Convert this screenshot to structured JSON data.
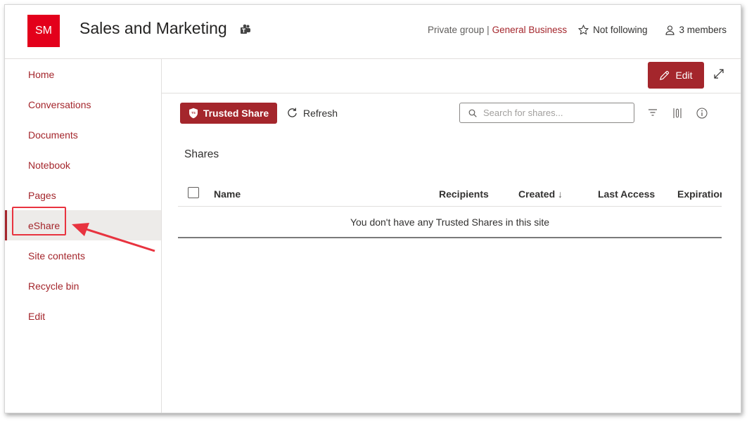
{
  "site": {
    "logo_text": "SM",
    "title": "Sales and Marketing",
    "privacy": "Private group |",
    "classification": "General Business",
    "follow": "Not following",
    "members": "3 members"
  },
  "nav": {
    "items": [
      "Home",
      "Conversations",
      "Documents",
      "Notebook",
      "Pages",
      "eShare",
      "Site contents",
      "Recycle bin",
      "Edit"
    ],
    "active": "eShare"
  },
  "toolbar": {
    "edit_label": "Edit"
  },
  "webpart": {
    "trusted_share_label": "Trusted Share",
    "refresh_label": "Refresh",
    "search_placeholder": "Search for shares...",
    "section_title": "Shares",
    "columns": [
      "Name",
      "Recipients",
      "Created",
      "Last Access",
      "Expiration"
    ],
    "sort_indicator": "↓",
    "empty_message": "You don't have any Trusted Shares in this site"
  },
  "colors": {
    "accent": "#a4262c",
    "logo_bg": "#e3001b",
    "callout": "#e8333f"
  },
  "icons": [
    "teams-icon",
    "star-icon",
    "person-icon",
    "pencil-icon",
    "expand-icon",
    "shield-icon",
    "refresh-icon",
    "search-icon",
    "filter-icon",
    "columns-icon",
    "info-icon",
    "arrow-icon"
  ]
}
